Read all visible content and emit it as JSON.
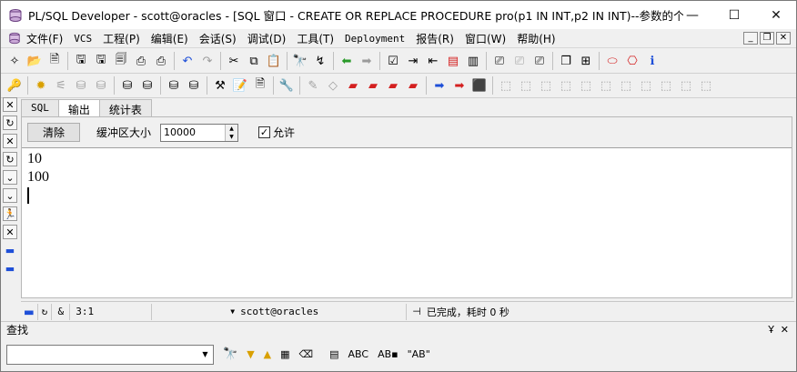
{
  "window": {
    "title": "PL/SQL Developer - scott@oracles - [SQL 窗口 - CREATE OR REPLACE PROCEDURE pro(p1 IN INT,p2 IN INT)--参数的个...",
    "minimize": "—",
    "maximize": "☐",
    "close": "✕"
  },
  "menu": {
    "items": [
      "文件(F)",
      "VCS",
      "工程(P)",
      "编辑(E)",
      "会话(S)",
      "调试(D)",
      "工具(T)",
      "Deployment",
      "报告(R)",
      "窗口(W)",
      "帮助(H)"
    ]
  },
  "tabs": [
    "SQL",
    "输出",
    "统计表"
  ],
  "controls": {
    "clear_label": "清除",
    "buffer_label": "缓冲区大小",
    "buffer_value": "10000",
    "allow_label": "允许",
    "allow_checked": "✓"
  },
  "output": {
    "lines": [
      "10",
      "100"
    ]
  },
  "status": {
    "position": "3:1",
    "amp": "&",
    "connection": "scott@oracles",
    "message": "已完成，耗时 0 秒"
  },
  "find": {
    "title": "查找",
    "pin": "Ұ",
    "close": "✕",
    "abc": "ABC",
    "ab_quoted": "\"AB\""
  },
  "colors": {
    "accent_blue": "#1e4fd8",
    "red_icon": "#d42020",
    "window_bg": "#f0f0f0"
  }
}
